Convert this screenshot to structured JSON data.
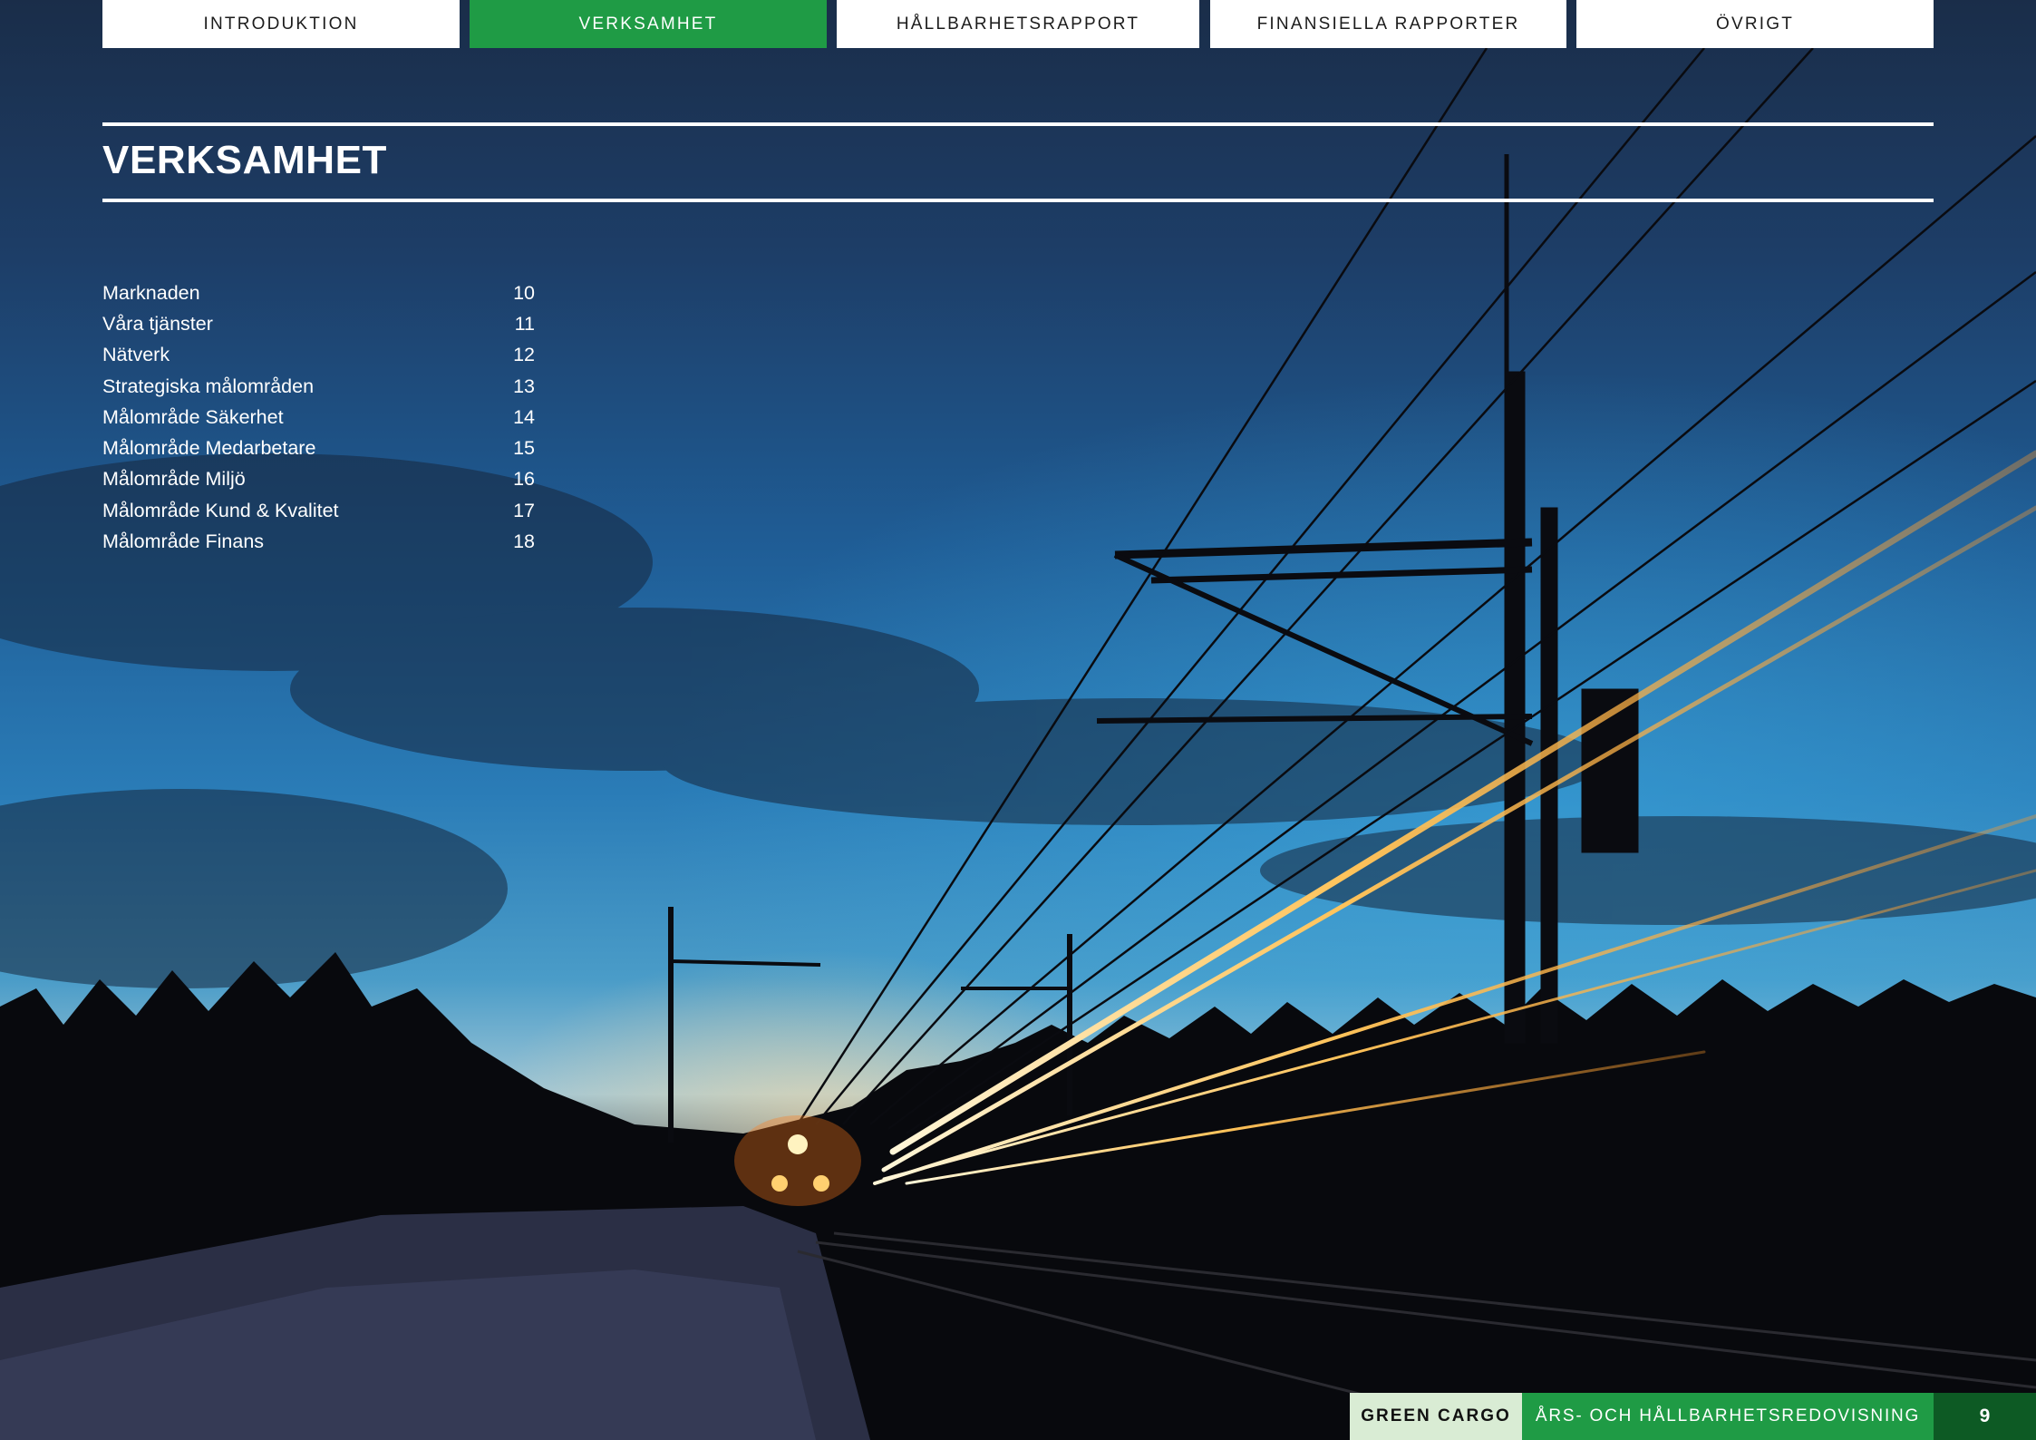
{
  "nav": {
    "tabs": [
      {
        "label": "INTRODUKTION",
        "active": false
      },
      {
        "label": "VERKSAMHET",
        "active": true
      },
      {
        "label": "HÅLLBARHETSRAPPORT",
        "active": false
      },
      {
        "label": "FINANSIELLA RAPPORTER",
        "active": false
      },
      {
        "label": "ÖVRIGT",
        "active": false
      }
    ]
  },
  "section": {
    "title": "VERKSAMHET"
  },
  "toc": {
    "items": [
      {
        "label": "Marknaden",
        "page": "10"
      },
      {
        "label": "Våra tjänster",
        "page": "11"
      },
      {
        "label": "Nätverk",
        "page": "12"
      },
      {
        "label": "Strategiska målområden",
        "page": "13"
      },
      {
        "label": "Målområde Säkerhet",
        "page": "14"
      },
      {
        "label": "Målområde Medarbetare",
        "page": "15"
      },
      {
        "label": "Målområde Miljö",
        "page": "16"
      },
      {
        "label": "Målområde Kund & Kvalitet",
        "page": "17"
      },
      {
        "label": "Målområde Finans",
        "page": "18"
      }
    ]
  },
  "footer": {
    "brand": "GREEN CARGO",
    "document": "ÅRS- OCH HÅLLBARHETSREDOVISNING",
    "page_number": "9"
  },
  "colors": {
    "accent_green": "#1f9b45",
    "dark_green": "#0d5a24",
    "light_green": "#d9ecd4"
  }
}
